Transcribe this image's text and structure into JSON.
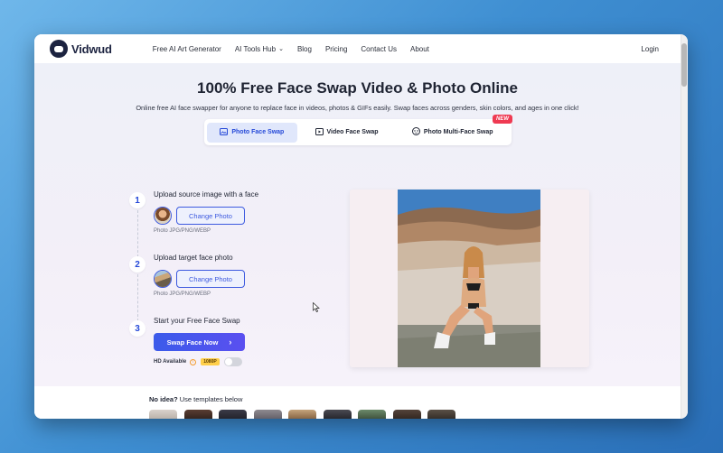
{
  "header": {
    "logo_text": "Vidwud",
    "nav": [
      {
        "label": "Free AI Art Generator"
      },
      {
        "label": "AI Tools Hub"
      },
      {
        "label": "Blog"
      },
      {
        "label": "Pricing"
      },
      {
        "label": "Contact Us"
      },
      {
        "label": "About"
      }
    ],
    "login": "Login"
  },
  "hero": {
    "title": "100% Free Face Swap Video & Photo Online",
    "subtitle": "Online free AI face swapper for anyone to replace face in videos, photos & GIFs easily. Swap faces across genders, skin colors, and ages in one click!"
  },
  "tabs": [
    {
      "label": "Photo Face Swap",
      "icon": "image-icon",
      "active": true
    },
    {
      "label": "Video Face Swap",
      "icon": "video-play-icon",
      "active": false
    },
    {
      "label": "Photo Multi-Face Swap",
      "icon": "multi-face-icon",
      "active": false
    }
  ],
  "new_badge": "NEW",
  "steps": [
    {
      "number": "1",
      "title": "Upload source image with a face",
      "button": "Change Photo",
      "hint": "Photo JPG/PNG/WEBP"
    },
    {
      "number": "2",
      "title": "Upload target face photo",
      "button": "Change Photo",
      "hint": "Photo JPG/PNG/WEBP"
    },
    {
      "number": "3",
      "title": "Start your Free Face Swap",
      "button": "Swap Face Now"
    }
  ],
  "hd": {
    "label": "HD Available",
    "resolution": "1080P",
    "enabled": false
  },
  "bottom": {
    "prefix": "No idea?",
    "text": " Use templates below"
  },
  "colors": {
    "accent": "#3d5adf",
    "new_badge": "#ef3a52",
    "bg_from": "#6fb7ea",
    "bg_to": "#2a6fb8"
  }
}
